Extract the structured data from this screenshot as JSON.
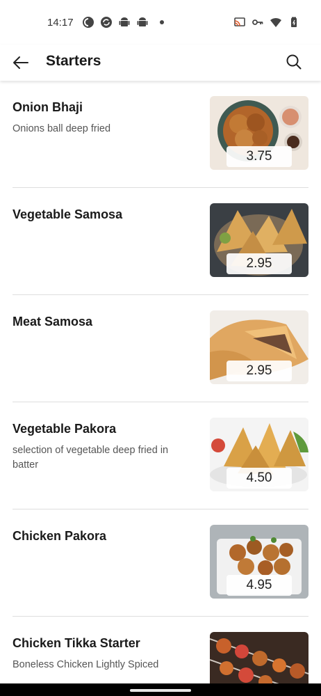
{
  "status_bar": {
    "time": "14:17",
    "left_icons": [
      "pocket-casts-icon",
      "sync-icon",
      "android-icon",
      "android-icon",
      "dot-icon"
    ],
    "right_icons": [
      "cast-icon",
      "vpn-key-icon",
      "wifi-icon",
      "battery-icon"
    ]
  },
  "app_bar": {
    "title": "Starters",
    "back_icon": "arrow-left-icon",
    "search_icon": "search-icon"
  },
  "items": [
    {
      "name": "Onion Bhaji",
      "description": "Onions ball deep fried",
      "price": "3.75",
      "image": "onion-bhaji-image"
    },
    {
      "name": "Vegetable Samosa",
      "description": "",
      "price": "2.95",
      "image": "vegetable-samosa-image"
    },
    {
      "name": "Meat Samosa",
      "description": "",
      "price": "2.95",
      "image": "meat-samosa-image"
    },
    {
      "name": "Vegetable Pakora",
      "description": "selection of vegetable deep fried in batter",
      "price": "4.50",
      "image": "vegetable-pakora-image"
    },
    {
      "name": "Chicken Pakora",
      "description": "",
      "price": "4.95",
      "image": "chicken-pakora-image"
    },
    {
      "name": "Chicken Tikka Starter",
      "description": "Boneless Chicken Lightly Spiced",
      "price": "",
      "image": "chicken-tikka-image"
    }
  ],
  "colors": {
    "background": "#ffffff",
    "text_primary": "#1a1a1a",
    "text_secondary": "#555555",
    "divider": "#dedede"
  }
}
